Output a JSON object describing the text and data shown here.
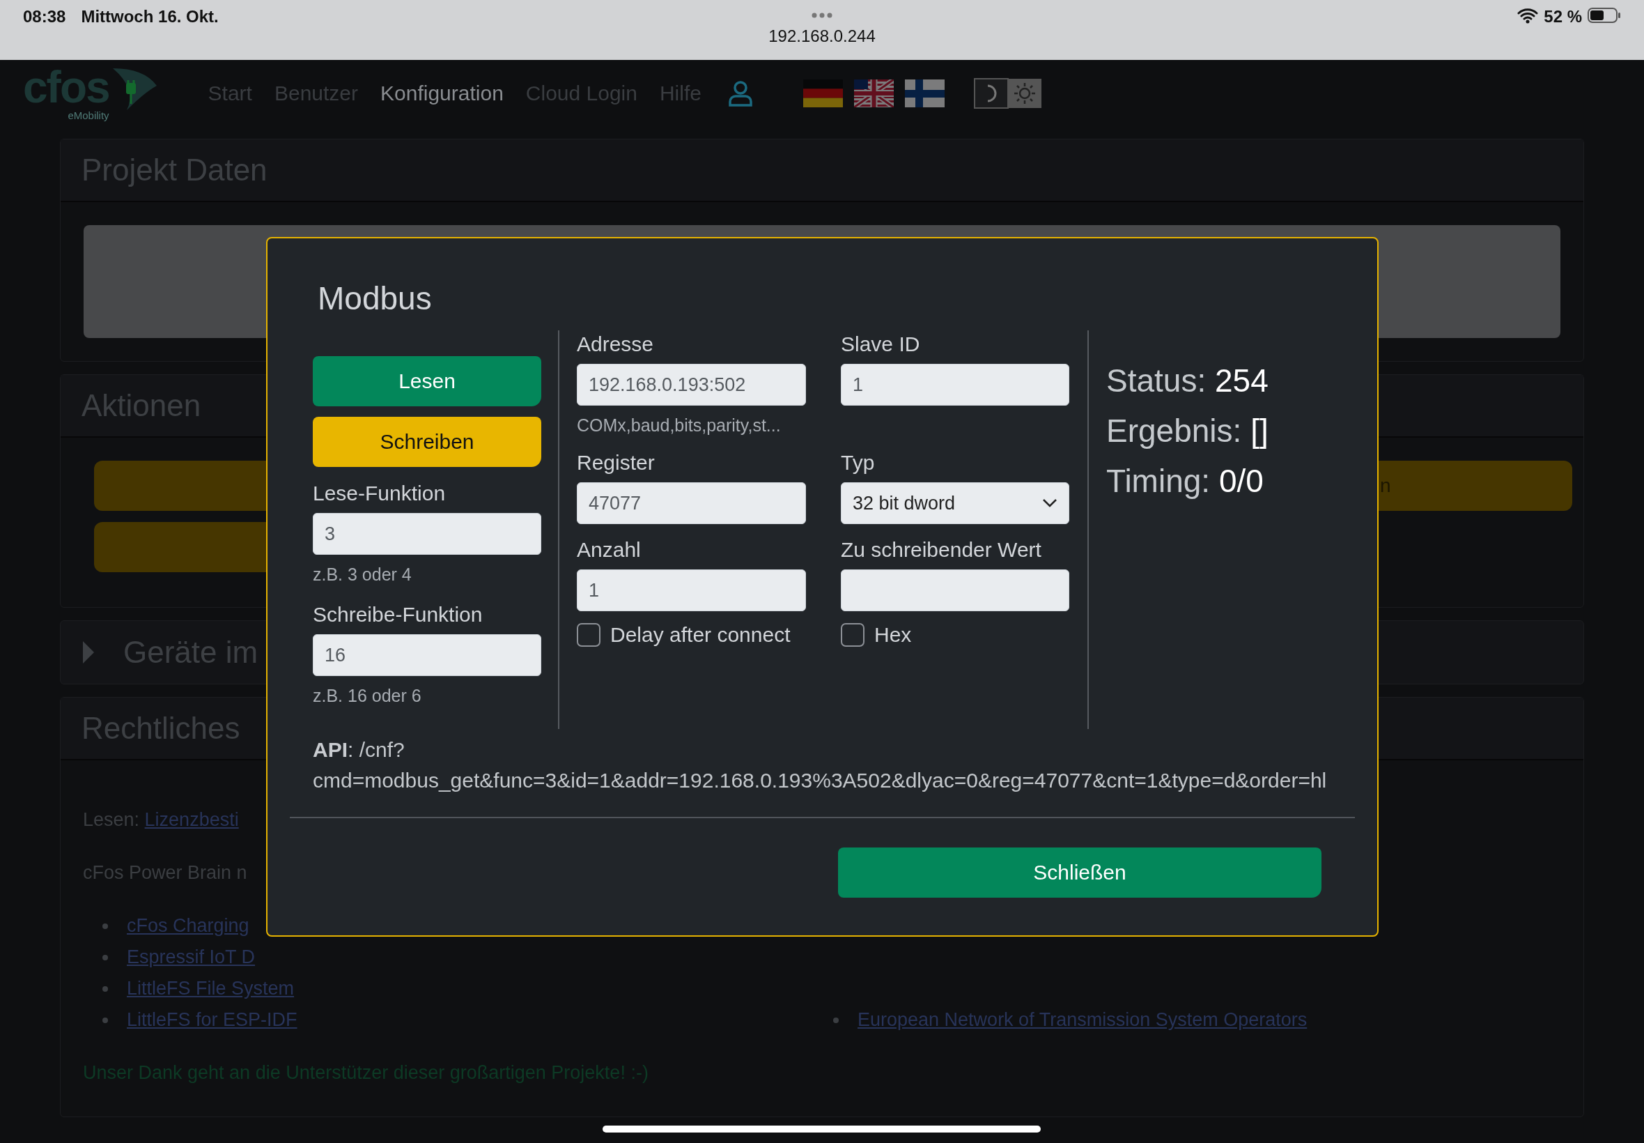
{
  "status_bar": {
    "time": "08:38",
    "date": "Mittwoch 16. Okt.",
    "url": "192.168.0.244",
    "battery": "52 %"
  },
  "nav": {
    "logo": "cfos",
    "logo_tagline": "eMobility",
    "items": [
      {
        "label": "Start",
        "selected": false
      },
      {
        "label": "Benutzer",
        "selected": false
      },
      {
        "label": "Konfiguration",
        "selected": true
      },
      {
        "label": "Cloud Login",
        "selected": false
      },
      {
        "label": "Hilfe",
        "selected": false
      }
    ],
    "languages": [
      {
        "kind": "de"
      },
      {
        "kind": "us"
      },
      {
        "kind": "fi"
      }
    ]
  },
  "page": {
    "project": {
      "title": "Projekt Daten"
    },
    "actions": {
      "title": "Aktionen",
      "buttons": [
        {
          "label": "n"
        }
      ]
    },
    "devices": {
      "title": "Geräte im",
      "expanded": false
    },
    "legal": {
      "title": "Rechtliches",
      "read_prefix": "Lesen:",
      "read_link": "Lizenzbesti",
      "intro": "cFos Power Brain n",
      "links_left": [
        "cFos Charging",
        "Espressif IoT D",
        "LittleFS File System",
        "LittleFS for ESP-IDF"
      ],
      "links_right": [
        "European Network of Transmission System Operators"
      ],
      "thanks": "Unser Dank geht an die Unterstützer dieser großartigen Projekte! :-)"
    }
  },
  "modal": {
    "title": "Modbus",
    "buttons": [
      {
        "label": "Lesen",
        "kind": "primary"
      },
      {
        "label": "Schreiben",
        "kind": "warning"
      }
    ],
    "left_fields": [
      {
        "label": "Lese-Funktion",
        "value": "3",
        "hint": "z.B. 3 oder 4"
      },
      {
        "label": "Schreibe-Funktion",
        "value": "16",
        "hint": "z.B. 16 oder 6"
      }
    ],
    "middle_fields": [
      {
        "kind": "input",
        "label": "Adresse",
        "value": "192.168.0.193:502",
        "hint": "COMx,baud,bits,parity,st..."
      },
      {
        "kind": "input",
        "label": "Register",
        "value": "47077"
      },
      {
        "kind": "input",
        "label": "Anzahl",
        "value": "1"
      },
      {
        "kind": "checkbox",
        "label": "Delay after connect",
        "checked": false
      }
    ],
    "right_fields": [
      {
        "kind": "input",
        "label": "Slave ID",
        "value": "1"
      },
      {
        "kind": "select",
        "label": "Typ",
        "value": "32 bit dword"
      },
      {
        "kind": "input",
        "label": "Zu schreibender Wert"
      },
      {
        "kind": "checkbox",
        "label": "Hex",
        "checked": false
      }
    ],
    "results": [
      {
        "label": "Status:",
        "value": "254"
      },
      {
        "label": "Ergebnis:",
        "value": "[]"
      },
      {
        "label": "Timing:",
        "value": "0/0"
      }
    ],
    "api": "**API**: /cnf?cmd=modbus_get&func=3&id=1&addr=192.168.0.193%3A502&dlyac=0&reg=47077&cnt=1&type=d&order=hl",
    "close_label": "Schließen"
  }
}
